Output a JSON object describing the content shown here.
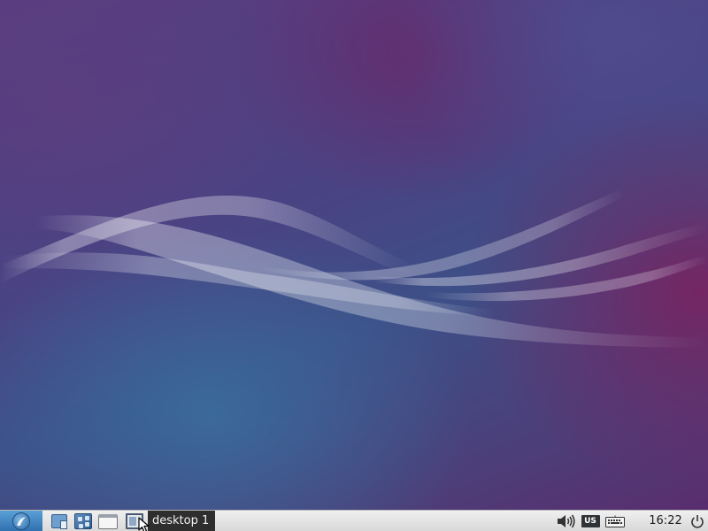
{
  "desktop": {
    "wallpaper": "lubuntu-waves"
  },
  "panel": {
    "menu_button_icon": "lubuntu-logo-icon",
    "launchers": [
      {
        "name": "file-manager",
        "icon": "file-manager-icon"
      },
      {
        "name": "web-browser",
        "icon": "network-browser-icon"
      },
      {
        "name": "terminal",
        "icon": "terminal-window-icon"
      }
    ],
    "show_desktop_icon": "show-desktop-icon",
    "taskbar": {
      "active_label": "desktop 1"
    },
    "tray": {
      "volume_icon": "speaker-icon",
      "keyboard_layout": "US",
      "keyboard_icon": "keyboard-icon",
      "clock": "16:22",
      "power_icon": "power-icon"
    }
  },
  "colors": {
    "panel_bg": "#e2e2e2",
    "menu_button": "#3b82c4",
    "taskbar_active": "#2e2e2e",
    "wallpaper_base": "#46488a"
  }
}
